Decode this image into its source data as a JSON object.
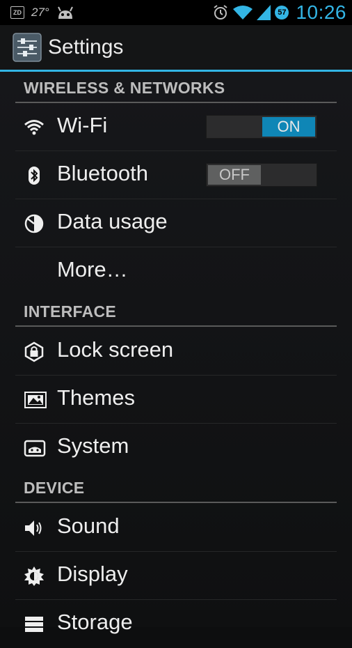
{
  "status_bar": {
    "zd_label": "ZD",
    "temperature": "27°",
    "time": "10:26",
    "notification_count": "57",
    "icons": [
      "zd-icon",
      "android-icon",
      "alarm-icon",
      "wifi-signal-icon",
      "cell-signal-icon",
      "badge-icon"
    ]
  },
  "action_bar": {
    "title": "Settings",
    "icon": "settings-app-icon"
  },
  "sections": {
    "wireless": {
      "header": "WIRELESS & NETWORKS",
      "items": [
        {
          "label": "Wi-Fi",
          "icon": "wifi-icon",
          "toggle": "ON"
        },
        {
          "label": "Bluetooth",
          "icon": "bluetooth-icon",
          "toggle": "OFF"
        },
        {
          "label": "Data usage",
          "icon": "data-usage-icon"
        },
        {
          "label": "More…"
        }
      ]
    },
    "interface": {
      "header": "INTERFACE",
      "items": [
        {
          "label": "Lock screen",
          "icon": "lock-icon"
        },
        {
          "label": "Themes",
          "icon": "themes-icon"
        },
        {
          "label": "System",
          "icon": "system-icon"
        }
      ]
    },
    "device": {
      "header": "DEVICE",
      "items": [
        {
          "label": "Sound",
          "icon": "sound-icon"
        },
        {
          "label": "Display",
          "icon": "display-icon"
        },
        {
          "label": "Storage",
          "icon": "storage-icon"
        }
      ]
    }
  },
  "colors": {
    "accent": "#33b5e5",
    "toggle_on": "#0f86b6",
    "background": "#0d0e0f"
  }
}
